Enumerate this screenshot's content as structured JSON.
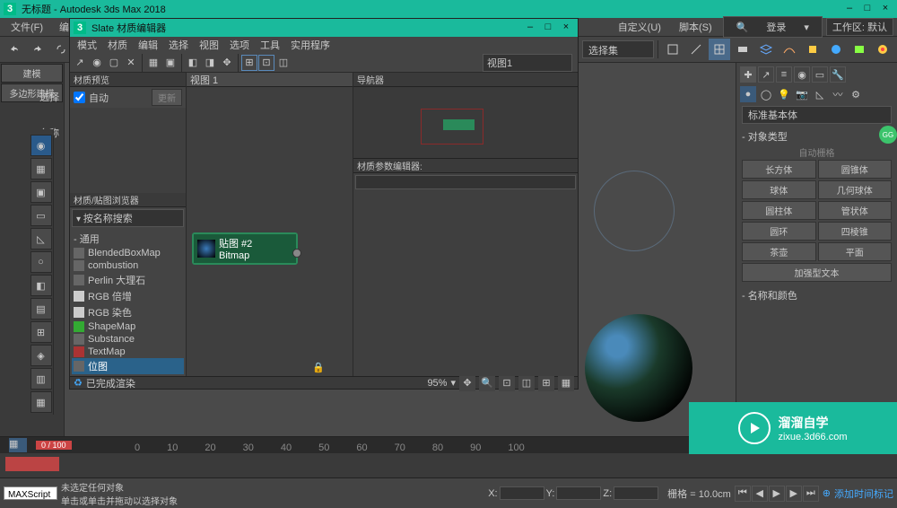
{
  "app": {
    "title": "无标题 - Autodesk 3ds Max 2018",
    "logo": "3"
  },
  "menubar": {
    "file": "文件(F)",
    "edit": "编",
    "custom": "自定义(U)",
    "script": "脚本(S)",
    "login": "登录",
    "workspace_label": "工作区: 默认"
  },
  "toolbar": {
    "dropdown": "选择集"
  },
  "left": {
    "model_tab": "建模",
    "poly_tab": "多边形建模",
    "select": "选择",
    "name": "名称"
  },
  "slate": {
    "title": "Slate 材质编辑器",
    "menu": {
      "mode": "模式",
      "material": "材质",
      "edit": "编辑",
      "select": "选择",
      "view": "视图",
      "options": "选项",
      "tools": "工具",
      "util": "实用程序"
    },
    "view_dd": "视图1",
    "preview_hdr": "材质预览",
    "auto": "自动",
    "update": "更新",
    "view1_tab": "视图 1",
    "nav_hdr": "导航器",
    "param_hdr": "材质参数编辑器:",
    "browser_hdr": "材质/贴图浏览器",
    "browser_search": "按名称搜索",
    "browser_cat": "- 通用",
    "browser_items": [
      "BlendedBoxMap",
      "combustion",
      "Perlin 大理石",
      "RGB 倍增",
      "RGB 染色",
      "ShapeMap",
      "Substance",
      "TextMap",
      "位图"
    ],
    "node_title": "贴图 #2",
    "node_type": "Bitmap",
    "footer": "已完成渲染",
    "zoom": "95%"
  },
  "right": {
    "std_primitives": "标准基本体",
    "obj_type": "对象类型",
    "auto_grid": "自动栅格",
    "buttons": [
      [
        "长方体",
        "圆锥体"
      ],
      [
        "球体",
        "几何球体"
      ],
      [
        "圆柱体",
        "管状体"
      ],
      [
        "圆环",
        "四棱锥"
      ],
      [
        "茶壶",
        "平面"
      ],
      [
        "加强型文本",
        ""
      ]
    ],
    "name_color": "名称和颜色"
  },
  "timeline": {
    "frame": "0 / 100",
    "ticks": [
      "0",
      "10",
      "20",
      "30",
      "40",
      "50",
      "60",
      "70",
      "80",
      "90",
      "100"
    ]
  },
  "status": {
    "no_sel": "未选定任何对象",
    "hint": "单击或单击并拖动以选择对象",
    "maxscript": "MAXScript  迷",
    "x": "X:",
    "y": "Y:",
    "z": "Z:",
    "grid": "栅格 = 10.0cm",
    "add_key": "添加时间标记"
  },
  "watermark": {
    "brand": "溜溜自学",
    "url": "zixue.3d66.com"
  },
  "gg": "GG"
}
